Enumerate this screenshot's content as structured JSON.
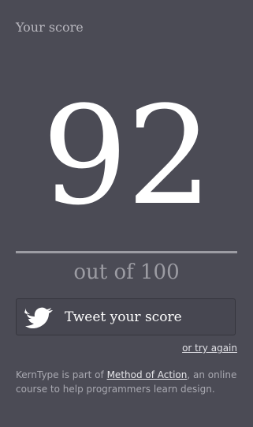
{
  "score_panel": {
    "heading": "Your score",
    "score": "92",
    "out_of": "out of 100"
  },
  "actions": {
    "tweet_label": "Tweet your score",
    "tweet_icon": "twitter-bird-icon",
    "retry_label": "or try again"
  },
  "footer": {
    "before_link": "KernType is part of ",
    "link_text": "Method of Action",
    "after_link": ", an online course to help programmers learn design."
  },
  "colors": {
    "background": "#4b4b55",
    "muted_text": "#9c9ca3",
    "score_text": "#ffffff"
  }
}
